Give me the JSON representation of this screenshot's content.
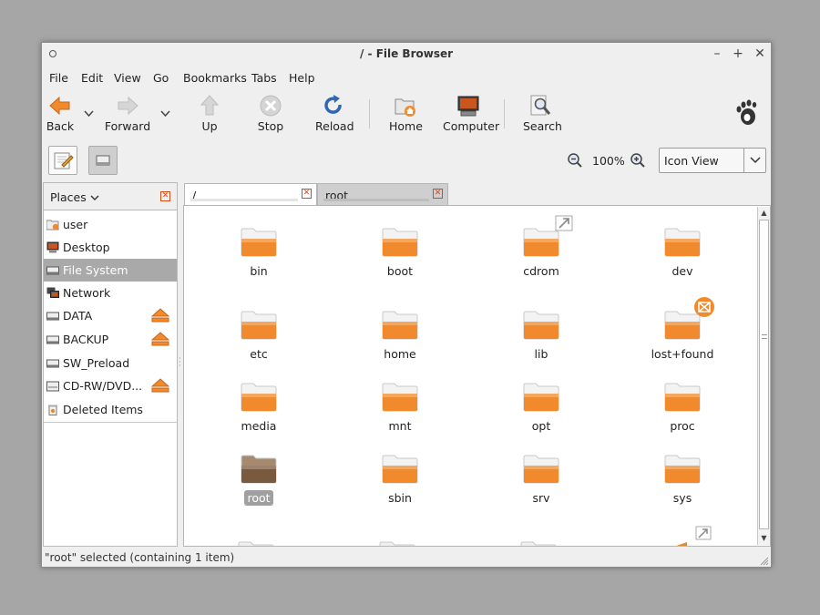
{
  "window": {
    "title": "/ - File Browser"
  },
  "menu": [
    "File",
    "Edit",
    "View",
    "Go",
    "Bookmarks",
    "Tabs",
    "Help"
  ],
  "toolbar": {
    "back": "Back",
    "forward": "Forward",
    "up": "Up",
    "stop": "Stop",
    "reload": "Reload",
    "home": "Home",
    "computer": "Computer",
    "search": "Search"
  },
  "location": {
    "zoom": "100%",
    "view_mode": "Icon View"
  },
  "places": {
    "header": "Places",
    "items": [
      {
        "label": "user",
        "icon": "home-folder-icon"
      },
      {
        "label": "Desktop",
        "icon": "desktop-icon"
      },
      {
        "label": "File System",
        "icon": "drive-icon",
        "selected": true
      },
      {
        "label": "Network",
        "icon": "network-icon"
      },
      {
        "label": "DATA",
        "icon": "drive-icon",
        "ejectable": true
      },
      {
        "label": "BACKUP",
        "icon": "drive-icon",
        "ejectable": true
      },
      {
        "label": "SW_Preload",
        "icon": "drive-icon"
      },
      {
        "label": "CD-RW/DVD...",
        "icon": "optical-drive-icon",
        "ejectable": true
      },
      {
        "label": "Deleted Items",
        "icon": "trash-icon"
      }
    ]
  },
  "tabs": [
    {
      "label": "/",
      "active": true
    },
    {
      "label": "root",
      "active": false
    }
  ],
  "files": [
    "bin",
    "boot",
    "cdrom",
    "dev",
    "etc",
    "home",
    "lib",
    "lost+found",
    "media",
    "mnt",
    "opt",
    "proc",
    "root",
    "sbin",
    "srv",
    "sys"
  ],
  "status": "\"root\" selected (containing 1 item)",
  "colors": {
    "folder": "#f08a2c",
    "selection": "#a9a9a9",
    "accent": "#e05a1c"
  }
}
